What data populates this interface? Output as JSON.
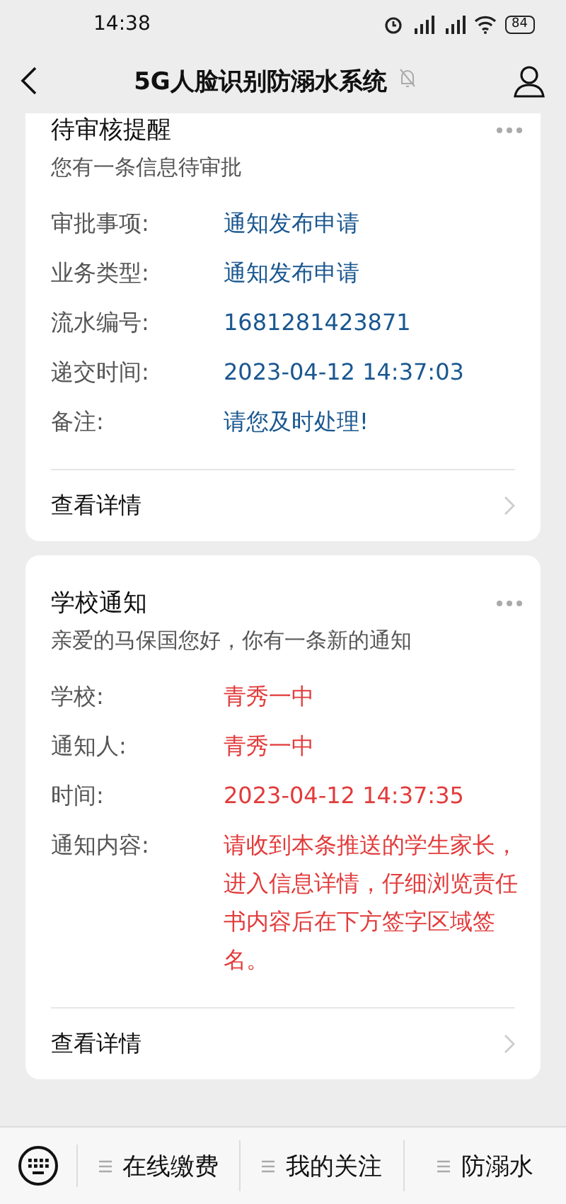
{
  "status_bar": {
    "time": "14:38",
    "battery": "84"
  },
  "header": {
    "title": "5G人脸识别防溺水系统",
    "muted": true
  },
  "cards": [
    {
      "title": "待审核提醒",
      "subtitle": "您有一条信息待审批",
      "color": "#1a5790",
      "fields": [
        {
          "label": "审批事项:",
          "value": "通知发布申请"
        },
        {
          "label": "业务类型:",
          "value": "通知发布申请"
        },
        {
          "label": "流水编号:",
          "value": "1681281423871"
        },
        {
          "label": "递交时间:",
          "value": "2023-04-12 14:37:03"
        },
        {
          "label": "备注:",
          "value": "请您及时处理!"
        }
      ],
      "link": "查看详情"
    },
    {
      "title": "学校通知",
      "subtitle": "亲爱的马保国您好，你有一条新的通知",
      "color": "#e23b3b",
      "fields": [
        {
          "label": "学校:",
          "value": "青秀一中"
        },
        {
          "label": "通知人:",
          "value": "青秀一中"
        },
        {
          "label": "时间:",
          "value": "2023-04-12 14:37:35"
        },
        {
          "label": "通知内容:",
          "value": "请收到本条推送的学生家长，进入信息详情，仔细浏览责任书内容后在下方签字区域签名。"
        }
      ],
      "link": "查看详情"
    }
  ],
  "bottom_menu": {
    "items": [
      "在线缴费",
      "我的关注",
      "防溺水"
    ]
  }
}
